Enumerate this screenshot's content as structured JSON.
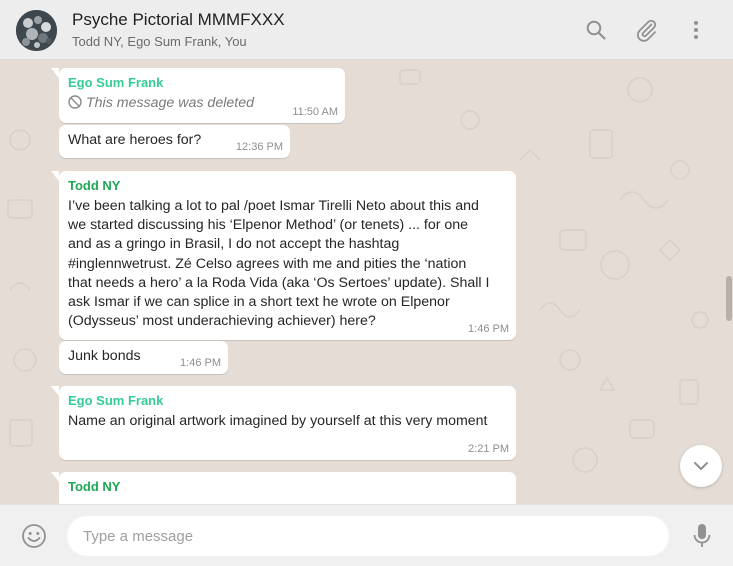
{
  "header": {
    "title": "Psyche Pictorial MMMFXXX",
    "participants": "Todd NY, Ego Sum Frank, You"
  },
  "colors": {
    "sender_frank": "#35cd96",
    "sender_todd": "#1fa855",
    "header_bg": "#ededed",
    "chat_bg": "#e5ddd5"
  },
  "icons": [
    "group-avatar",
    "search-icon",
    "paperclip-icon",
    "menu-icon",
    "scroll-down-icon",
    "emoji-icon",
    "mic-icon"
  ],
  "messages": [
    {
      "sender": "Ego Sum Frank",
      "text": "This message was deleted",
      "time": "11:50 AM"
    },
    {
      "text": "What are heroes for?",
      "time": "12:36 PM"
    },
    {
      "sender": "Todd NY",
      "lines": [
        "I’ve been talking a lot to pal /poet Ismar Tirelli Neto about this and",
        "we started discussing his ‘Elpenor Method’ (or tenets) ... for one",
        "and as a gringo in Brasil, I do not accept the hashtag",
        "#inglennwetrust. Zé Celso agrees with me and pities the ‘nation",
        "that needs a hero’ a la Roda Vida (aka ‘Os Sertoes’ update). Shall I",
        "ask Ismar if we can splice in a short text he wrote on Elpenor",
        "(Odysseus’ most underachieving achiever) here?"
      ],
      "time": "1:46 PM"
    },
    {
      "text": "Junk bonds",
      "time": "1:46 PM"
    },
    {
      "sender": "Ego Sum Frank",
      "text": "Name an original artwork imagined by yourself at this very moment",
      "time": "2:21 PM"
    },
    {
      "sender": "Todd NY"
    }
  ],
  "composer": {
    "placeholder": "Type a message",
    "value": ""
  }
}
